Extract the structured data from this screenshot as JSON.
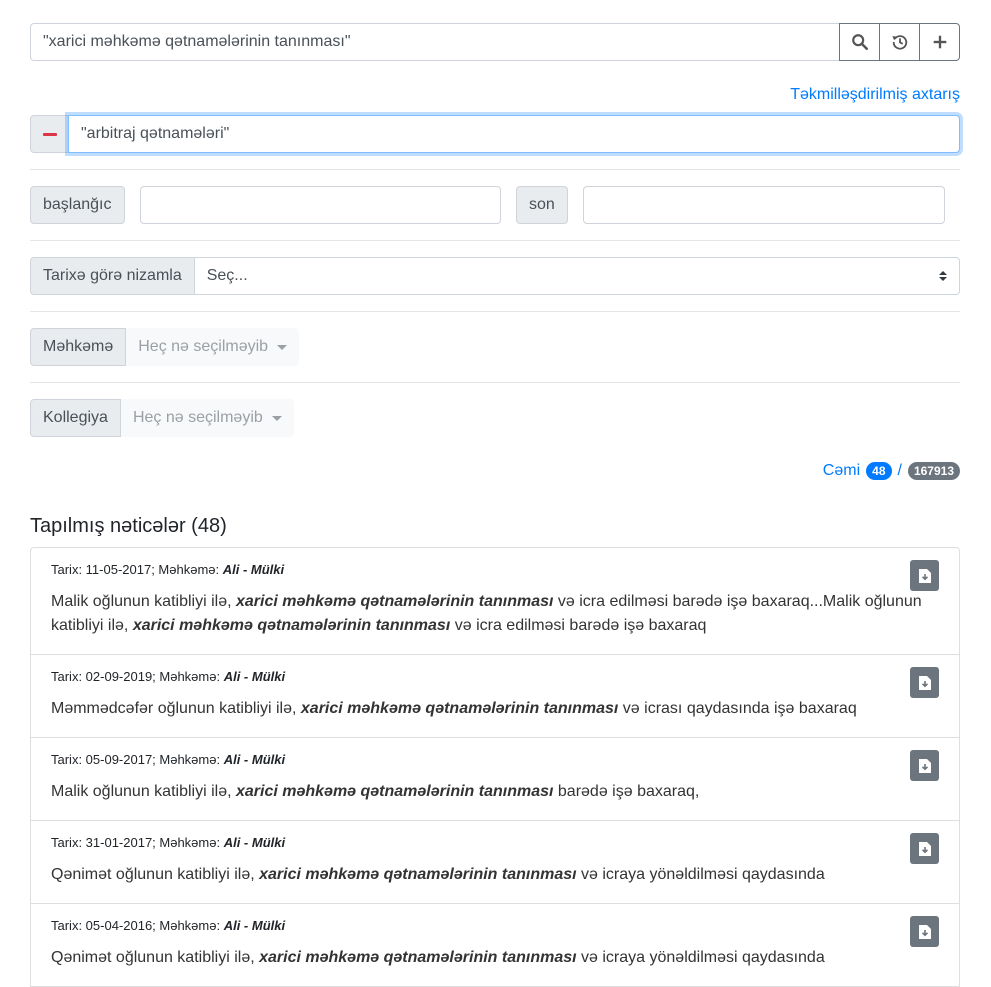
{
  "search": {
    "query": "\"xarici məhkəmə qətnamələrinin tanınması\"",
    "buttons": [
      "search-icon",
      "history-icon",
      "plus-icon"
    ]
  },
  "advanced_link": "Təkmilləşdirilmiş axtarış",
  "extra_term": "\"arbitraj qətnamələri\"",
  "date_range": {
    "start_label": "başlanğıc",
    "end_label": "son",
    "start_value": "",
    "end_value": ""
  },
  "sort": {
    "label": "Tarixə görə nizamla",
    "selected": "Seç..."
  },
  "court_filter": {
    "label": "Məhkəmə",
    "value": "Heç nə seçilməyib"
  },
  "collegium_filter": {
    "label": "Kollegiya",
    "value": "Heç nə seçilməyib"
  },
  "totals": {
    "label": "Cəmi",
    "found": "48",
    "separator": "/",
    "all": "167913"
  },
  "results_title": "Tapılmış nəticələr (48)",
  "results": [
    {
      "date_prefix": "Tarix: 11-05-2017; Məhkəmə: ",
      "court": "Ali - Mülki",
      "before": "Malik oğlunun katibliyi ilə, ",
      "hit": "xarici məhkəmə qətnamələrinin tanınması",
      "middle": " və icra edilməsi barədə işə baxaraq...Malik oğlunun katibliyi ilə, ",
      "hit2": "xarici məhkəmə qətnamələrinin tanınması",
      "after": " və icra edilməsi barədə işə baxaraq"
    },
    {
      "date_prefix": "Tarix: 02-09-2019; Məhkəmə: ",
      "court": "Ali - Mülki",
      "before": "Məmmədcəfər oğlunun katibliyi ilə, ",
      "hit": "xarici məhkəmə qətnamələrinin tanınması",
      "after": " və icrası qaydasında işə baxaraq"
    },
    {
      "date_prefix": "Tarix: 05-09-2017; Məhkəmə: ",
      "court": "Ali - Mülki",
      "before": "Malik oğlunun katibliyi ilə, ",
      "hit": "xarici məhkəmə qətnamələrinin tanınması",
      "after": " barədə işə baxaraq,"
    },
    {
      "date_prefix": "Tarix: 31-01-2017; Məhkəmə: ",
      "court": "Ali - Mülki",
      "before": "Qənimət oğlunun katibliyi ilə, ",
      "hit": "xarici məhkəmə qətnamələrinin tanınması",
      "after": " və icraya yönəldilməsi qaydasında"
    },
    {
      "date_prefix": "Tarix: 05-04-2016; Məhkəmə: ",
      "court": "Ali - Mülki",
      "before": "Qənimət oğlunun katibliyi ilə, ",
      "hit": "xarici məhkəmə qətnamələrinin tanınması",
      "after": " və icraya yönəldilməsi qaydasında"
    }
  ]
}
